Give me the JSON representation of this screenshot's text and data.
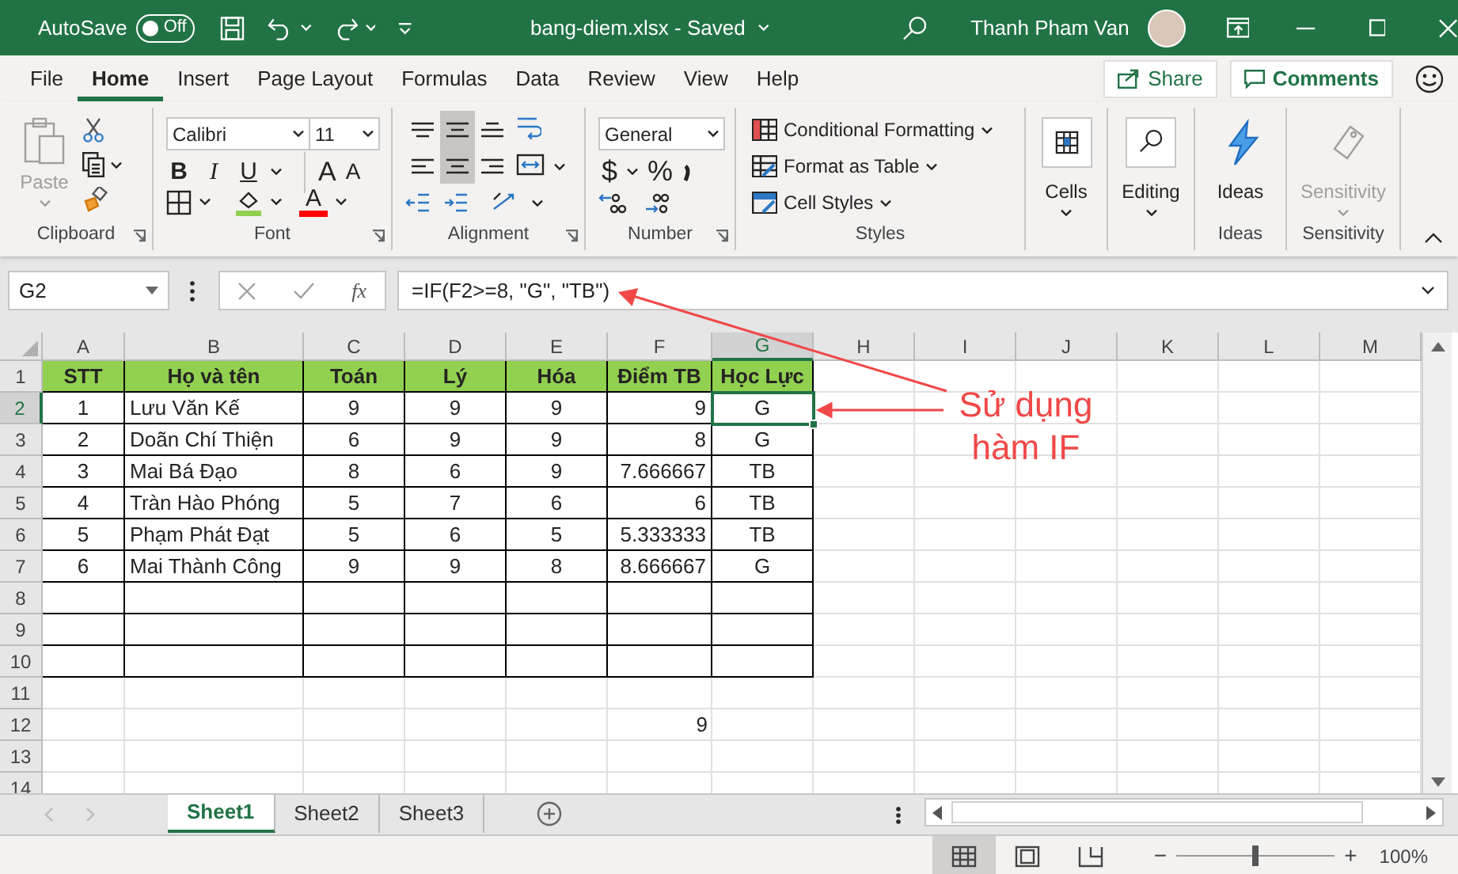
{
  "title_bar": {
    "autosave_label": "AutoSave",
    "autosave_on": false,
    "autosave_state": "Off",
    "file_title": "bang-diem.xlsx  -  Saved",
    "user_name": "Thanh Pham Van"
  },
  "tabs": [
    {
      "label": "File",
      "selected": false
    },
    {
      "label": "Home",
      "selected": true
    },
    {
      "label": "Insert",
      "selected": false
    },
    {
      "label": "Page Layout",
      "selected": false
    },
    {
      "label": "Formulas",
      "selected": false
    },
    {
      "label": "Data",
      "selected": false
    },
    {
      "label": "Review",
      "selected": false
    },
    {
      "label": "View",
      "selected": false
    },
    {
      "label": "Help",
      "selected": false
    }
  ],
  "share_button": "Share",
  "comments_button": "Comments",
  "ribbon": {
    "groups": [
      {
        "kind": "clipboard",
        "label": "Clipboard",
        "paste": {
          "label": "Paste",
          "disabled": true
        }
      },
      {
        "kind": "font",
        "label": "Font",
        "font_name": "Calibri",
        "font_size": "11",
        "bold": "B",
        "italic": "I",
        "underline": "U",
        "grow": "A",
        "shrink": "A",
        "font_color": "A"
      },
      {
        "kind": "alignment",
        "label": "Alignment",
        "buttons": [
          {
            "kind": "top",
            "selected": false
          },
          {
            "kind": "middle",
            "selected": true
          },
          {
            "kind": "bottom",
            "selected": false
          },
          {
            "kind": "left",
            "selected": false
          },
          {
            "kind": "center",
            "selected": true
          },
          {
            "kind": "right",
            "selected": false
          }
        ]
      },
      {
        "kind": "number",
        "label": "Number",
        "format": "General",
        "currency": "$",
        "percent": "%"
      },
      {
        "kind": "styles",
        "label": "Styles",
        "items": [
          "Conditional Formatting",
          "Format as Table",
          "Cell Styles"
        ]
      },
      {
        "kind": "cells",
        "button": "Cells",
        "disabled": false
      },
      {
        "kind": "editing",
        "button": "Editing",
        "disabled": false
      },
      {
        "kind": "ideas",
        "label": "Ideas",
        "button": "Ideas",
        "disabled": false
      },
      {
        "kind": "sensitivity",
        "label": "Sensitivity",
        "button": "Sensitivity",
        "disabled": true
      }
    ]
  },
  "formula_bar": {
    "name_box": "G2",
    "fx": "fx",
    "formula": "=IF(F2>=8, \"G\", \"TB\")"
  },
  "sheet": {
    "columns": [
      {
        "label": "A",
        "selected": false
      },
      {
        "label": "B",
        "selected": false
      },
      {
        "label": "C",
        "selected": false
      },
      {
        "label": "D",
        "selected": false
      },
      {
        "label": "E",
        "selected": false
      },
      {
        "label": "F",
        "selected": false
      },
      {
        "label": "G",
        "selected": true
      },
      {
        "label": "H",
        "selected": false
      },
      {
        "label": "I",
        "selected": false
      },
      {
        "label": "J",
        "selected": false
      },
      {
        "label": "K",
        "selected": false
      },
      {
        "label": "L",
        "selected": false
      },
      {
        "label": "M",
        "selected": false
      }
    ],
    "rows": [
      {
        "label": "1",
        "kind": "header",
        "selected": false,
        "cells": [
          "STT",
          "Họ và tên",
          "Toán",
          "Lý",
          "Hóa",
          "Điểm TB",
          "Học Lực"
        ]
      },
      {
        "label": "2",
        "kind": "data",
        "selected": true,
        "cells": [
          "1",
          "Lưu Văn Kế",
          "9",
          "9",
          "9",
          "9",
          "G"
        ]
      },
      {
        "label": "3",
        "kind": "data",
        "selected": false,
        "cells": [
          "2",
          "Doãn Chí Thiện",
          "6",
          "9",
          "9",
          "8",
          "G"
        ]
      },
      {
        "label": "4",
        "kind": "data",
        "selected": false,
        "cells": [
          "3",
          "Mai Bá Đạo",
          "8",
          "6",
          "9",
          "7.666667",
          "TB"
        ]
      },
      {
        "label": "5",
        "kind": "data",
        "selected": false,
        "cells": [
          "4",
          "Tràn Hào Phóng",
          "5",
          "7",
          "6",
          "6",
          "TB"
        ]
      },
      {
        "label": "6",
        "kind": "data",
        "selected": false,
        "cells": [
          "5",
          "Phạm Phát Đạt",
          "5",
          "6",
          "5",
          "5.333333",
          "TB"
        ]
      },
      {
        "label": "7",
        "kind": "data",
        "selected": false,
        "cells": [
          "6",
          "Mai Thành Công",
          "9",
          "9",
          "8",
          "8.666667",
          "G"
        ]
      },
      {
        "label": "8",
        "kind": "data",
        "selected": false,
        "cells": []
      },
      {
        "label": "9",
        "kind": "data",
        "selected": false,
        "cells": []
      },
      {
        "label": "10",
        "kind": "data",
        "selected": false,
        "cells": []
      },
      {
        "label": "11",
        "kind": "plain",
        "selected": false,
        "cells": []
      },
      {
        "label": "12",
        "kind": "plain",
        "selected": false,
        "cells": [
          null,
          null,
          null,
          null,
          null,
          "9"
        ]
      },
      {
        "label": "13",
        "kind": "plain",
        "selected": false,
        "cells": []
      },
      {
        "label": "14",
        "kind": "plain",
        "selected": false,
        "cells": []
      }
    ]
  },
  "annotation": {
    "text": "Sử dụng\nhàm IF"
  },
  "sheet_tabs": [
    {
      "label": "Sheet1",
      "selected": true
    },
    {
      "label": "Sheet2",
      "selected": false
    },
    {
      "label": "Sheet3",
      "selected": false
    }
  ],
  "status_bar": {
    "views": [
      {
        "kind": "normal",
        "selected": true
      },
      {
        "kind": "page-layout",
        "selected": false
      },
      {
        "kind": "page-break",
        "selected": false
      }
    ],
    "zoom_minus": "−",
    "zoom_plus": "+",
    "zoom": {
      "level": 0.5
    },
    "zoom_label": "100%"
  }
}
